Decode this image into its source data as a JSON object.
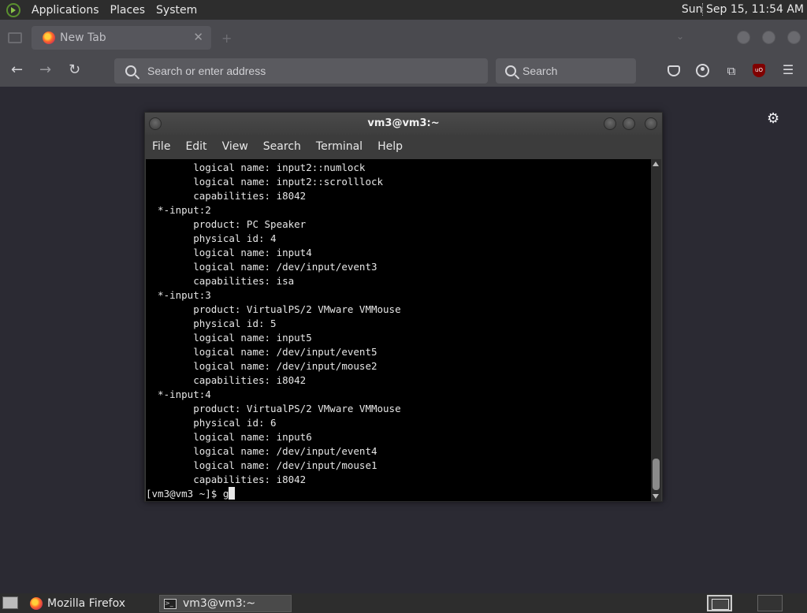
{
  "top_panel": {
    "menus": [
      "Applications",
      "Places",
      "System"
    ],
    "clock": "Sun Sep 15, 11:54 AM"
  },
  "browser": {
    "tab_title": "New Tab",
    "tab_close": "✕",
    "new_tab": "+",
    "list_tabs": "⌄",
    "back_icon": "←",
    "forward_icon": "→",
    "reload_icon": "↻",
    "url_placeholder": "Search or enter address",
    "search_placeholder": "Search",
    "extensions_icon": "⧉",
    "ublock_label": "uO",
    "menu_icon": "☰",
    "settings_icon": "⚙"
  },
  "terminal": {
    "title": "vm3@vm3:~",
    "menus": [
      "File",
      "Edit",
      "View",
      "Search",
      "Terminal",
      "Help"
    ],
    "lines": [
      "        logical name: input2::numlock",
      "        logical name: input2::scrolllock",
      "        capabilities: i8042",
      "  *-input:2",
      "        product: PC Speaker",
      "        physical id: 4",
      "        logical name: input4",
      "        logical name: /dev/input/event3",
      "        capabilities: isa",
      "  *-input:3",
      "        product: VirtualPS/2 VMware VMMouse",
      "        physical id: 5",
      "        logical name: input5",
      "        logical name: /dev/input/event5",
      "        logical name: /dev/input/mouse2",
      "        capabilities: i8042",
      "  *-input:4",
      "        product: VirtualPS/2 VMware VMMouse",
      "        physical id: 6",
      "        logical name: input6",
      "        logical name: /dev/input/event4",
      "        logical name: /dev/input/mouse1",
      "        capabilities: i8042"
    ],
    "prompt": "[vm3@vm3 ~]$ ",
    "typed": "g"
  },
  "taskbar": {
    "tasks": [
      "Mozilla Firefox",
      "vm3@vm3:~"
    ]
  }
}
